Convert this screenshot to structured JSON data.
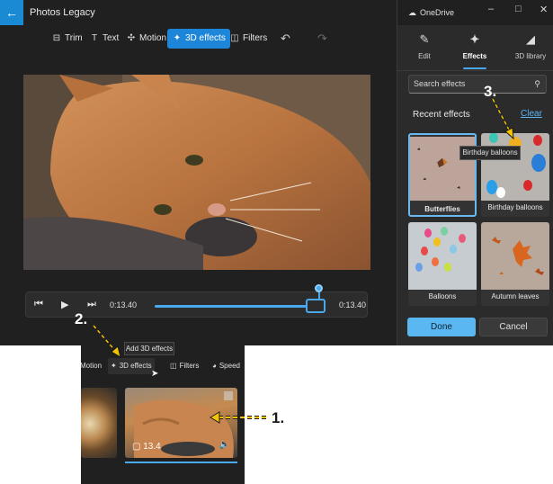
{
  "titlebar": {
    "back_icon": "arrow-left-icon",
    "app_title": "Photos Legacy"
  },
  "toolbar": {
    "trim": "Trim",
    "text": "Text",
    "motion": "Motion",
    "effects3d": "3D effects",
    "filters": "Filters",
    "undo_icon": "undo-icon",
    "redo_icon": "redo-icon"
  },
  "playbar": {
    "current_time": "0:13.40",
    "end_time": "0:13.40",
    "progress": 1.0
  },
  "panel": {
    "account": "OneDrive",
    "tabs": [
      {
        "label": "Edit",
        "icon": "pencil-icon"
      },
      {
        "label": "Effects",
        "icon": "sparkle-icon"
      },
      {
        "label": "3D library",
        "icon": "cube-icon"
      }
    ],
    "active_tab": "Effects",
    "search_placeholder": "Search effects",
    "recent_label": "Recent effects",
    "clear_label": "Clear",
    "effects": [
      "Butterflies",
      "Birthday balloons",
      "Balloons",
      "Autumn leaves"
    ],
    "selected_effect": "Butterflies",
    "tooltip": "Birthday balloons",
    "done_label": "Done",
    "cancel_label": "Cancel"
  },
  "inset": {
    "tooltip": "Add 3D effects",
    "toolbar": {
      "motion": "Motion",
      "effects3d": "3D effects",
      "filters": "Filters",
      "speed": "Speed"
    },
    "clip_duration": "13.4"
  },
  "steps": {
    "one": "1.",
    "two": "2.",
    "three": "3."
  },
  "colors": {
    "accent": "#1e86d8",
    "step_arrow": "#f4c400",
    "panel_bg": "#2b2b2b"
  }
}
